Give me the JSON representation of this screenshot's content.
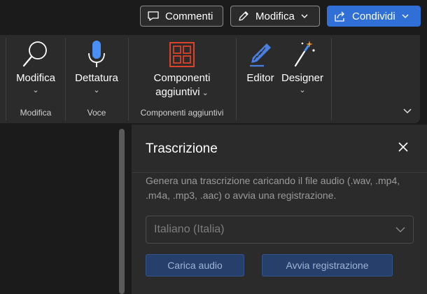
{
  "topbar": {
    "comments_label": "Commenti",
    "edit_label": "Modifica",
    "share_label": "Condividi"
  },
  "ribbon": {
    "groups": [
      {
        "label": "Modifica",
        "buttons": [
          {
            "label": "Modifica",
            "icon": "search-icon"
          }
        ]
      },
      {
        "label": "Voce",
        "buttons": [
          {
            "label": "Dettatura",
            "icon": "microphone-icon"
          }
        ]
      },
      {
        "label": "Componenti aggiuntivi",
        "buttons": [
          {
            "label_line1": "Componenti",
            "label_line2": "aggiuntivi",
            "icon": "addins-grid-icon"
          }
        ]
      },
      {
        "label": "",
        "buttons": [
          {
            "label": "Editor",
            "icon": "editor-pen-icon"
          },
          {
            "label": "Designer",
            "icon": "designer-wand-icon"
          }
        ]
      }
    ]
  },
  "pane": {
    "title": "Trascrizione",
    "description": "Genera una trascrizione caricando il file audio (.wav, .mp4, .m4a, .mp3, .aac) o avvia una registrazione.",
    "language_value": "Italiano (Italia)",
    "upload_label": "Carica audio",
    "record_label": "Avvia registrazione"
  },
  "colors": {
    "accent": "#2f6fd6",
    "ribbon_bg": "#2b2b2b",
    "app_bg": "#1b1b1b",
    "addins_icon": "#d9442b",
    "editor_icon": "#4a7fe0",
    "disabled_button_bg": "#26406b"
  }
}
